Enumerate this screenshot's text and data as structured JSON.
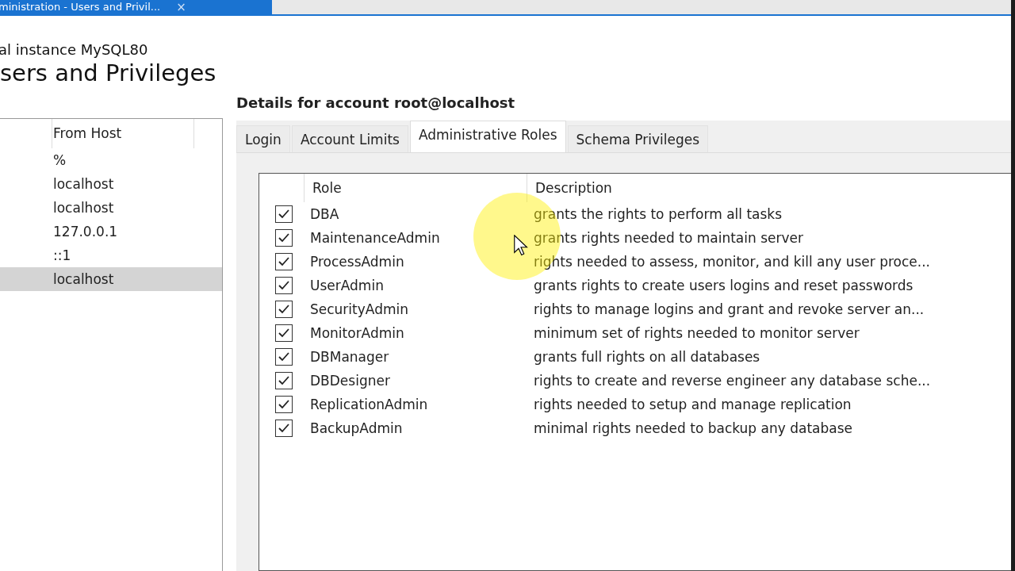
{
  "document_tab": {
    "title": "ministration - Users and Privil...",
    "close": "×"
  },
  "header": {
    "subtitle": "al instance MySQL80",
    "title": "sers and Privileges"
  },
  "accounts": {
    "columns": [
      "From Host"
    ],
    "rows": [
      {
        "host": "%",
        "selected": false
      },
      {
        "host": "localhost",
        "selected": false
      },
      {
        "host": "localhost",
        "selected": false
      },
      {
        "host": "127.0.0.1",
        "selected": false
      },
      {
        "host": "::1",
        "selected": false
      },
      {
        "host": "localhost",
        "selected": true
      }
    ]
  },
  "details": {
    "title": "Details for account root@localhost",
    "tabs": [
      {
        "label": "Login",
        "selected": false
      },
      {
        "label": "Account Limits",
        "selected": false
      },
      {
        "label": "Administrative Roles",
        "selected": true
      },
      {
        "label": "Schema Privileges",
        "selected": false
      }
    ],
    "roles_table": {
      "columns": [
        "Role",
        "Description"
      ],
      "rows": [
        {
          "checked": true,
          "role": "DBA",
          "description": "grants the rights to perform all tasks"
        },
        {
          "checked": true,
          "role": "MaintenanceAdmin",
          "description": "grants rights needed to maintain server"
        },
        {
          "checked": true,
          "role": "ProcessAdmin",
          "description": "rights needed to assess, monitor, and kill any user proce..."
        },
        {
          "checked": true,
          "role": "UserAdmin",
          "description": "grants rights to create users logins and reset passwords"
        },
        {
          "checked": true,
          "role": "SecurityAdmin",
          "description": "rights to manage logins and grant and revoke server an..."
        },
        {
          "checked": true,
          "role": "MonitorAdmin",
          "description": "minimum set of rights needed to monitor server"
        },
        {
          "checked": true,
          "role": "DBManager",
          "description": "grants full rights on all databases"
        },
        {
          "checked": true,
          "role": "DBDesigner",
          "description": "rights to create and reverse engineer any database sche..."
        },
        {
          "checked": true,
          "role": "ReplicationAdmin",
          "description": "rights needed to setup and manage replication"
        },
        {
          "checked": true,
          "role": "BackupAdmin",
          "description": "minimal rights needed to backup any database"
        }
      ]
    }
  }
}
